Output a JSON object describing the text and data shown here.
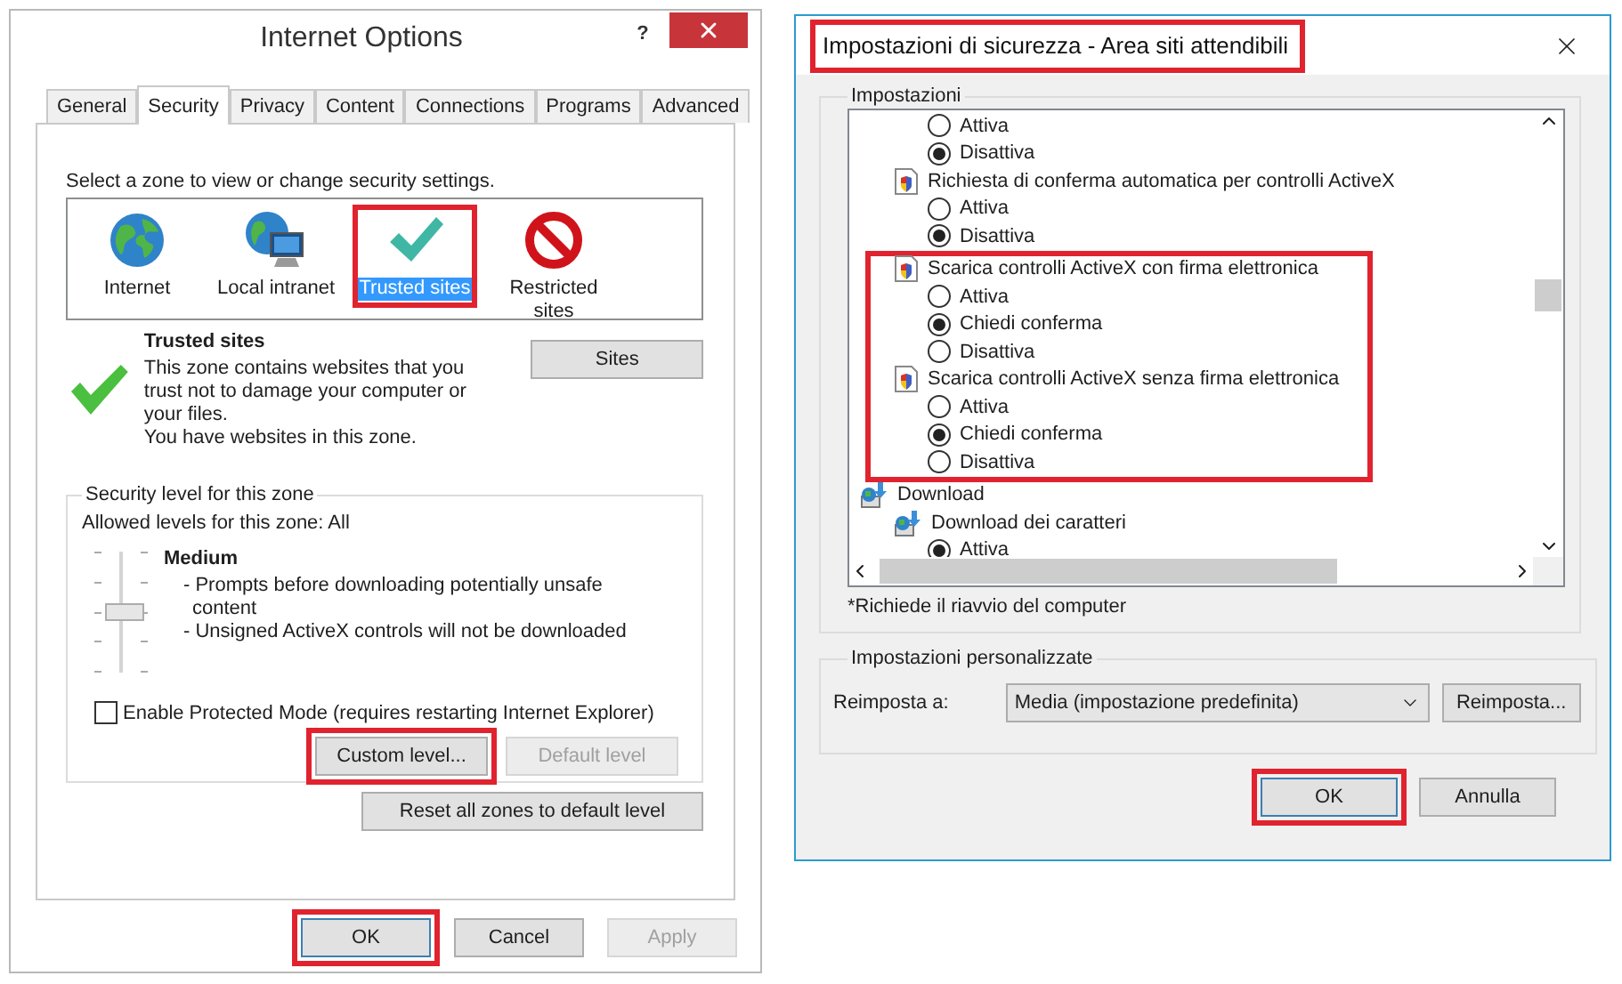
{
  "internet_options": {
    "title": "Internet Options",
    "help_label": "?",
    "tabs": [
      {
        "label": "General",
        "selected": false
      },
      {
        "label": "Security",
        "selected": true
      },
      {
        "label": "Privacy",
        "selected": false
      },
      {
        "label": "Content",
        "selected": false
      },
      {
        "label": "Connections",
        "selected": false
      },
      {
        "label": "Programs",
        "selected": false
      },
      {
        "label": "Advanced",
        "selected": false
      }
    ],
    "zone_prompt": "Select a zone to view or change security settings.",
    "zones": [
      {
        "label": "Internet",
        "kind": "globe",
        "selected": false,
        "highlighted": false
      },
      {
        "label": "Local intranet",
        "kind": "intranet",
        "selected": false,
        "highlighted": false
      },
      {
        "label": "Trusted sites",
        "kind": "trusted",
        "selected": true,
        "highlighted": true
      },
      {
        "label": "Restricted sites",
        "kind": "restricted",
        "selected": false,
        "highlighted": false
      }
    ],
    "zone_info": {
      "title": "Trusted sites",
      "description": "This zone contains websites that you trust not to damage your computer or your files.",
      "note": "You have websites in this zone."
    },
    "sites_button": "Sites",
    "security_level": {
      "legend": "Security level for this zone",
      "allowed": "Allowed levels for this zone: All",
      "level": 0.5,
      "name": "Medium",
      "bullets": [
        "- Prompts before downloading potentially unsafe content",
        "- Unsigned ActiveX controls will not be downloaded"
      ]
    },
    "protected_mode": {
      "label": "Enable Protected Mode (requires restarting Internet Explorer)",
      "checked": false
    },
    "level_buttons": [
      {
        "label": "Custom level...",
        "disabled": false,
        "highlighted": true
      },
      {
        "label": "Default level",
        "disabled": true,
        "highlighted": false
      }
    ],
    "reset_button": "Reset all zones to default level",
    "buttons": [
      {
        "label": "OK",
        "default": true,
        "disabled": false,
        "highlighted": true
      },
      {
        "label": "Cancel",
        "default": false,
        "disabled": false,
        "highlighted": false
      },
      {
        "label": "Apply",
        "default": false,
        "disabled": true,
        "highlighted": false
      }
    ]
  },
  "security_settings": {
    "title": "Impostazioni di sicurezza - Area siti attendibili",
    "title_highlighted": true,
    "settings_legend": "Impostazioni",
    "tree": [
      {
        "kind": "option",
        "label": "Attiva",
        "selected": false
      },
      {
        "kind": "option",
        "label": "Disattiva",
        "selected": true
      },
      {
        "kind": "setting",
        "label": "Richiesta di conferma automatica per controlli ActiveX",
        "highlighted": false,
        "children": [
          {
            "kind": "option",
            "label": "Attiva",
            "selected": false
          },
          {
            "kind": "option",
            "label": "Disattiva",
            "selected": true
          }
        ]
      },
      {
        "kind": "setting",
        "label": "Scarica controlli ActiveX con firma elettronica",
        "highlighted": true,
        "children": [
          {
            "kind": "option",
            "label": "Attiva",
            "selected": false
          },
          {
            "kind": "option",
            "label": "Chiedi conferma",
            "selected": true
          },
          {
            "kind": "option",
            "label": "Disattiva",
            "selected": false
          }
        ]
      },
      {
        "kind": "setting",
        "label": "Scarica controlli ActiveX senza firma elettronica",
        "highlighted": true,
        "children": [
          {
            "kind": "option",
            "label": "Attiva",
            "selected": false
          },
          {
            "kind": "option",
            "label": "Chiedi conferma",
            "selected": true
          },
          {
            "kind": "option",
            "label": "Disattiva",
            "selected": false
          }
        ]
      },
      {
        "kind": "category",
        "label": "Download",
        "children": [
          {
            "kind": "download",
            "label": "Download dei caratteri",
            "children": [
              {
                "kind": "option",
                "label": "Attiva",
                "selected": true
              }
            ]
          }
        ]
      }
    ],
    "footnote": "*Richiede il riavvio del computer",
    "custom_legend": "Impostazioni personalizzate",
    "reset_label": "Reimposta a:",
    "reset_value": "Media (impostazione predefinita)",
    "reset_button": "Reimposta...",
    "buttons": [
      {
        "label": "OK",
        "default": true,
        "highlighted": true
      },
      {
        "label": "Annulla",
        "default": false,
        "highlighted": false
      }
    ]
  }
}
